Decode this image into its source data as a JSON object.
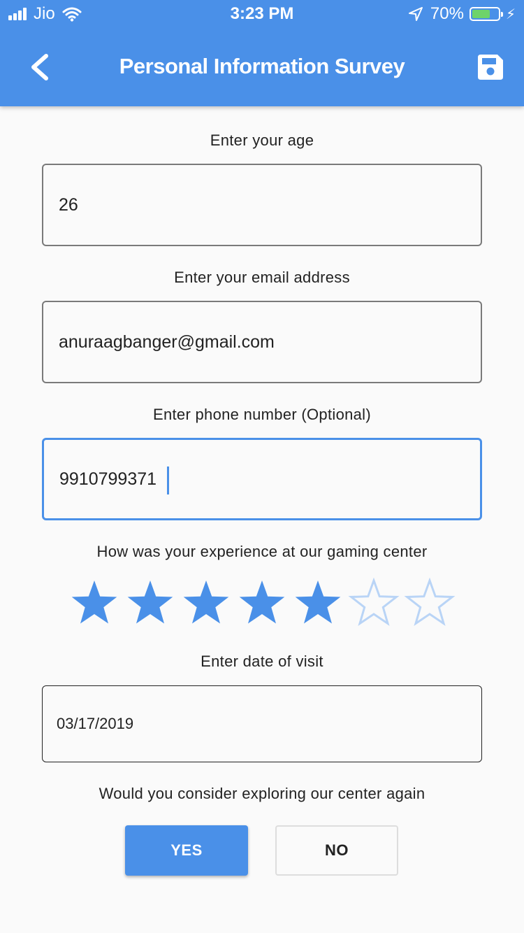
{
  "status_bar": {
    "carrier": "Jio",
    "time": "3:23 PM",
    "battery_percent": "70%",
    "battery_level": 0.7,
    "icons": [
      "signal-icon",
      "wifi-icon",
      "location-arrow-icon",
      "battery-icon",
      "charging-bolt-icon"
    ]
  },
  "app_bar": {
    "title": "Personal Information Survey",
    "back_icon": "chevron-left-icon",
    "save_icon": "floppy-disk-icon"
  },
  "form": {
    "age": {
      "label": "Enter your age",
      "value": "26"
    },
    "email": {
      "label": "Enter your email address",
      "value": "anuraagbanger@gmail.com"
    },
    "phone": {
      "label": "Enter phone number (Optional)",
      "value": "9910799371"
    },
    "experience": {
      "label": "How was your experience at our gaming center",
      "rating": 5,
      "max": 7
    },
    "date": {
      "label": "Enter date of visit",
      "value": "03/17/2019"
    },
    "revisit": {
      "label": "Would you consider exploring our center again",
      "yes_label": "YES",
      "no_label": "NO",
      "selected": "YES"
    }
  },
  "colors": {
    "primary": "#4a90e8",
    "star_filled": "#4a90e8",
    "star_empty": "#b9d4f6",
    "background": "#fafafa",
    "battery_fill": "#6ed36a"
  }
}
